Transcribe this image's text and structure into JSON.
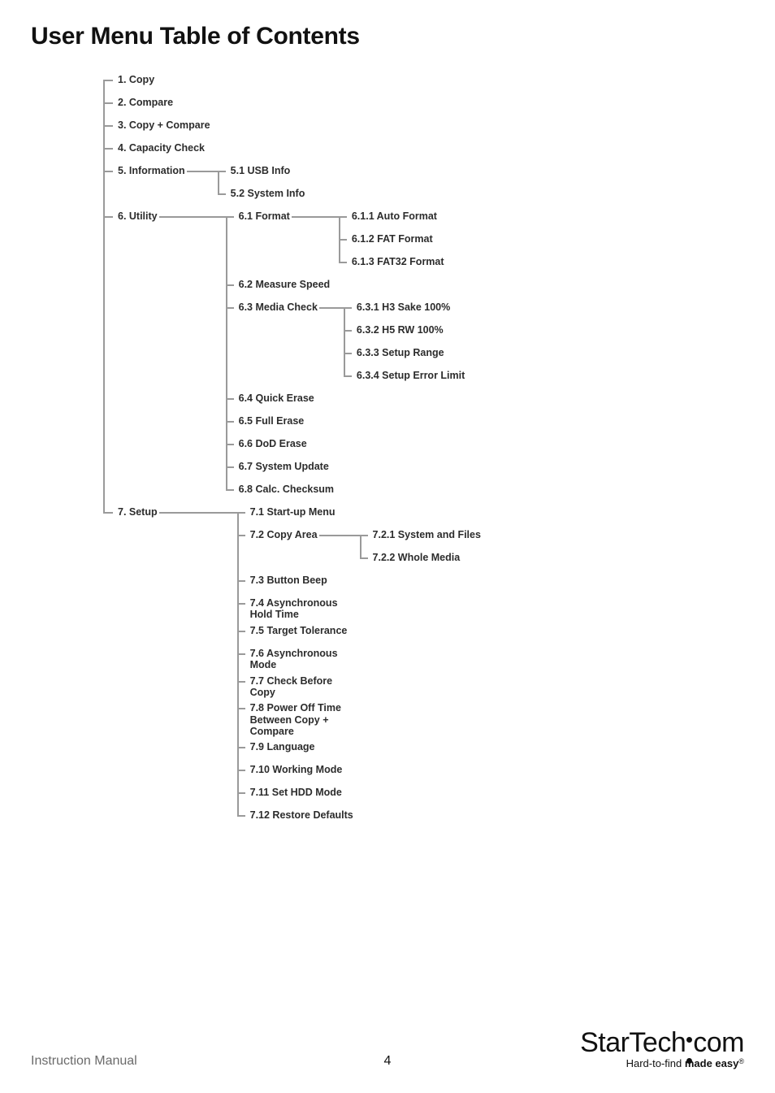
{
  "title": "User Menu Table of Contents",
  "tree": {
    "n1": "1. Copy",
    "n2": "2. Compare",
    "n3": "3. Copy + Compare",
    "n4": "4. Capacity Check",
    "n5": "5. Information",
    "n5_1": "5.1 USB Info",
    "n5_2": "5.2 System Info",
    "n6": "6. Utility",
    "n6_1": "6.1 Format",
    "n6_1_1": "6.1.1 Auto Format",
    "n6_1_2": "6.1.2 FAT Format",
    "n6_1_3": "6.1.3 FAT32 Format",
    "n6_2": "6.2 Measure Speed",
    "n6_3": "6.3 Media Check",
    "n6_3_1": "6.3.1 H3 Sake 100%",
    "n6_3_2": "6.3.2 H5 RW 100%",
    "n6_3_3": "6.3.3 Setup Range",
    "n6_3_4": "6.3.4 Setup Error Limit",
    "n6_4": "6.4 Quick Erase",
    "n6_5": "6.5 Full Erase",
    "n6_6": "6.6 DoD Erase",
    "n6_7": "6.7 System Update",
    "n6_8": "6.8 Calc. Checksum",
    "n7": "7. Setup",
    "n7_1": "7.1 Start-up Menu",
    "n7_2": "7.2 Copy Area",
    "n7_2_1": "7.2.1 System and Files",
    "n7_2_2": "7.2.2 Whole Media",
    "n7_3": "7.3 Button Beep",
    "n7_4": "7.4 Asynchronous Hold Time",
    "n7_5": "7.5 Target Tolerance",
    "n7_6": "7.6 Asynchronous Mode",
    "n7_7": "7.7 Check Before Copy",
    "n7_8": "7.8 Power Off Time Between Copy + Compare",
    "n7_9": "7.9 Language",
    "n7_10": "7.10 Working Mode",
    "n7_11": "7.11 Set HDD Mode",
    "n7_12": "7.12 Restore Defaults"
  },
  "footer": {
    "left": "Instruction Manual",
    "page": "4",
    "brand_a": "StarTech",
    "brand_b": "com",
    "tagline_a": "Hard-to-find ",
    "tagline_b": "made easy",
    "reg": "®"
  }
}
